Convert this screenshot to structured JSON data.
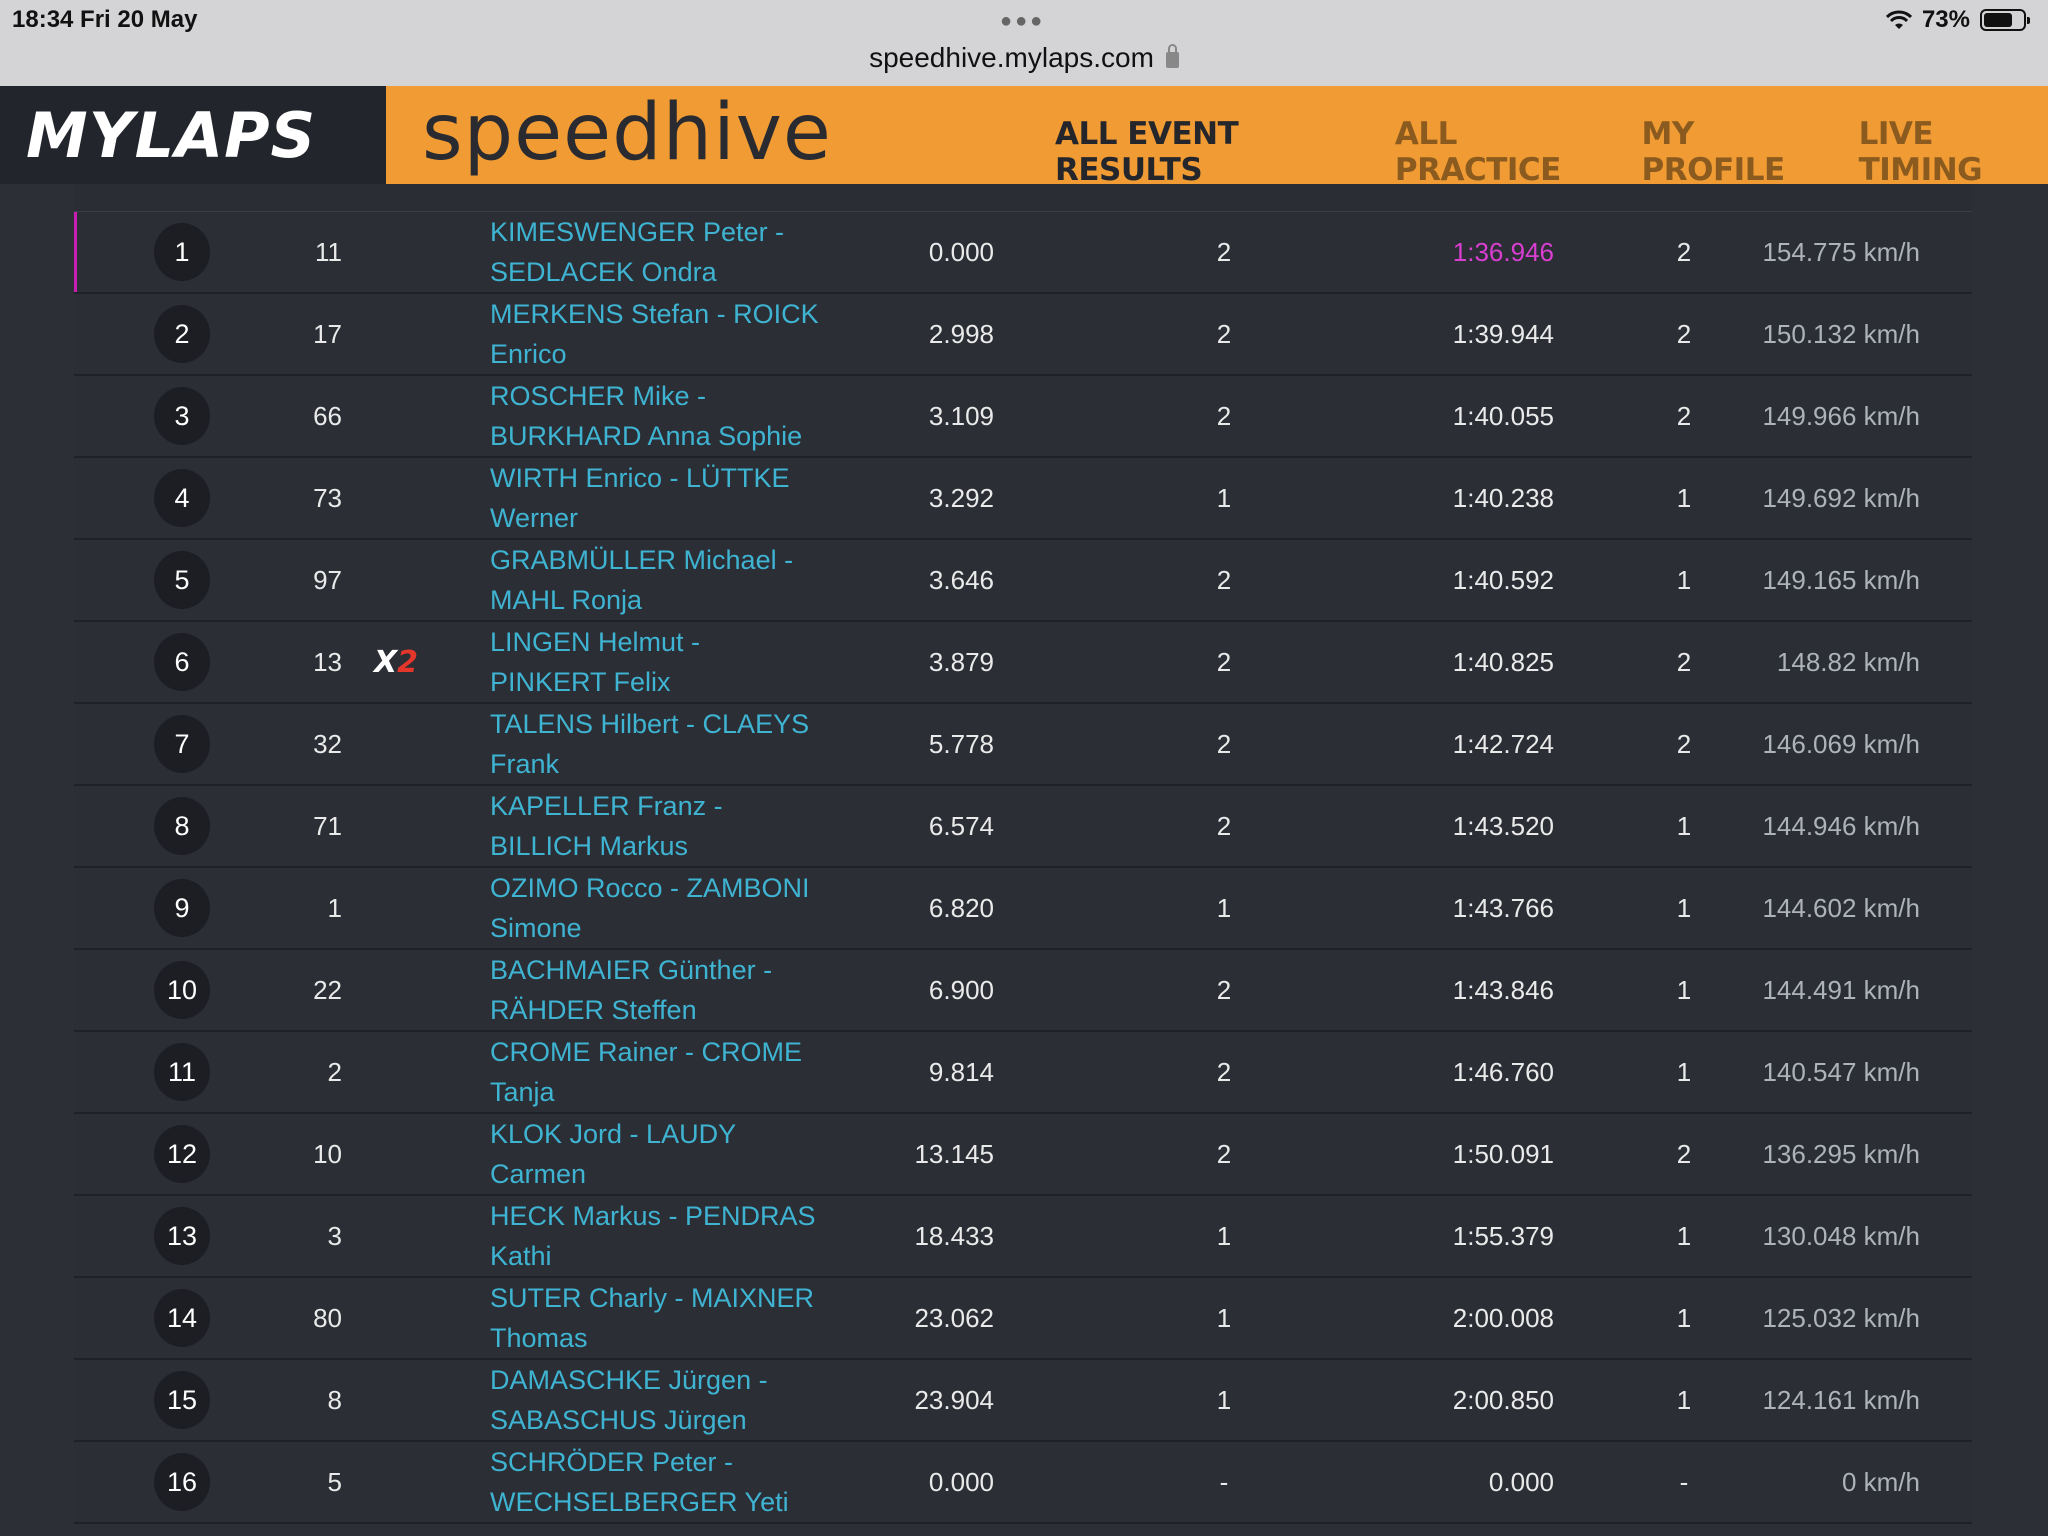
{
  "statusbar": {
    "time_date": "18:34   Fri 20 May",
    "url": "speedhive.mylaps.com",
    "battery": "73%",
    "battery_level": 0.73
  },
  "header": {
    "logo": "MYLAPS",
    "brand": "speedhive",
    "nav": [
      {
        "label": "ALL EVENT RESULTS",
        "active": true
      },
      {
        "label": "ALL PRACTICE",
        "active": false
      },
      {
        "label": "MY PROFILE",
        "active": false
      },
      {
        "label": "LIVE TIMING",
        "active": false
      }
    ]
  },
  "colors": {
    "accent": "#f09b34",
    "link": "#3fb4d2",
    "best_lap": "#d83ed0",
    "background": "#2b2e35"
  },
  "results": [
    {
      "pos": "1",
      "num": "11",
      "tag": "",
      "name_line1": "KIMESWENGER Peter -",
      "name_line2": "SEDLACEK Ondra",
      "diff": "0.000",
      "laps": "2",
      "best": "1:36.946",
      "in_lap": "2",
      "speed": "154.775 km/h"
    },
    {
      "pos": "2",
      "num": "17",
      "tag": "",
      "name_line1": "MERKENS Stefan - ROICK",
      "name_line2": "Enrico",
      "diff": "2.998",
      "laps": "2",
      "best": "1:39.944",
      "in_lap": "2",
      "speed": "150.132 km/h"
    },
    {
      "pos": "3",
      "num": "66",
      "tag": "",
      "name_line1": "ROSCHER Mike -",
      "name_line2": "BURKHARD Anna Sophie",
      "diff": "3.109",
      "laps": "2",
      "best": "1:40.055",
      "in_lap": "2",
      "speed": "149.966 km/h"
    },
    {
      "pos": "4",
      "num": "73",
      "tag": "",
      "name_line1": "WIRTH Enrico - LÜTTKE",
      "name_line2": "Werner",
      "diff": "3.292",
      "laps": "1",
      "best": "1:40.238",
      "in_lap": "1",
      "speed": "149.692 km/h"
    },
    {
      "pos": "5",
      "num": "97",
      "tag": "",
      "name_line1": "GRABMÜLLER Michael -",
      "name_line2": "MAHL Ronja",
      "diff": "3.646",
      "laps": "2",
      "best": "1:40.592",
      "in_lap": "1",
      "speed": "149.165 km/h"
    },
    {
      "pos": "6",
      "num": "13",
      "tag": "X2",
      "name_line1": "LINGEN Helmut -",
      "name_line2": "PINKERT Felix",
      "diff": "3.879",
      "laps": "2",
      "best": "1:40.825",
      "in_lap": "2",
      "speed": "148.82 km/h"
    },
    {
      "pos": "7",
      "num": "32",
      "tag": "",
      "name_line1": "TALENS Hilbert - CLAEYS",
      "name_line2": "Frank",
      "diff": "5.778",
      "laps": "2",
      "best": "1:42.724",
      "in_lap": "2",
      "speed": "146.069 km/h"
    },
    {
      "pos": "8",
      "num": "71",
      "tag": "",
      "name_line1": "KAPELLER Franz -",
      "name_line2": "BILLICH Markus",
      "diff": "6.574",
      "laps": "2",
      "best": "1:43.520",
      "in_lap": "1",
      "speed": "144.946 km/h"
    },
    {
      "pos": "9",
      "num": "1",
      "tag": "",
      "name_line1": "OZIMO Rocco - ZAMBONI",
      "name_line2": "Simone",
      "diff": "6.820",
      "laps": "1",
      "best": "1:43.766",
      "in_lap": "1",
      "speed": "144.602 km/h"
    },
    {
      "pos": "10",
      "num": "22",
      "tag": "",
      "name_line1": "BACHMAIER Günther -",
      "name_line2": "RÄHDER Steffen",
      "diff": "6.900",
      "laps": "2",
      "best": "1:43.846",
      "in_lap": "1",
      "speed": "144.491 km/h"
    },
    {
      "pos": "11",
      "num": "2",
      "tag": "",
      "name_line1": "CROME Rainer - CROME",
      "name_line2": "Tanja",
      "diff": "9.814",
      "laps": "2",
      "best": "1:46.760",
      "in_lap": "1",
      "speed": "140.547 km/h"
    },
    {
      "pos": "12",
      "num": "10",
      "tag": "",
      "name_line1": "KLOK Jord - LAUDY",
      "name_line2": "Carmen",
      "diff": "13.145",
      "laps": "2",
      "best": "1:50.091",
      "in_lap": "2",
      "speed": "136.295 km/h"
    },
    {
      "pos": "13",
      "num": "3",
      "tag": "",
      "name_line1": "HECK Markus - PENDRAS",
      "name_line2": "Kathi",
      "diff": "18.433",
      "laps": "1",
      "best": "1:55.379",
      "in_lap": "1",
      "speed": "130.048 km/h"
    },
    {
      "pos": "14",
      "num": "80",
      "tag": "",
      "name_line1": "SUTER Charly - MAIXNER",
      "name_line2": "Thomas",
      "diff": "23.062",
      "laps": "1",
      "best": "2:00.008",
      "in_lap": "1",
      "speed": "125.032 km/h"
    },
    {
      "pos": "15",
      "num": "8",
      "tag": "",
      "name_line1": "DAMASCHKE Jürgen -",
      "name_line2": "SABASCHUS Jürgen",
      "diff": "23.904",
      "laps": "1",
      "best": "2:00.850",
      "in_lap": "1",
      "speed": "124.161 km/h"
    },
    {
      "pos": "16",
      "num": "5",
      "tag": "",
      "name_line1": "SCHRÖDER Peter -",
      "name_line2": "WECHSELBERGER Yeti",
      "diff": "0.000",
      "laps": "-",
      "best": "0.000",
      "in_lap": "-",
      "speed": "0 km/h"
    }
  ]
}
